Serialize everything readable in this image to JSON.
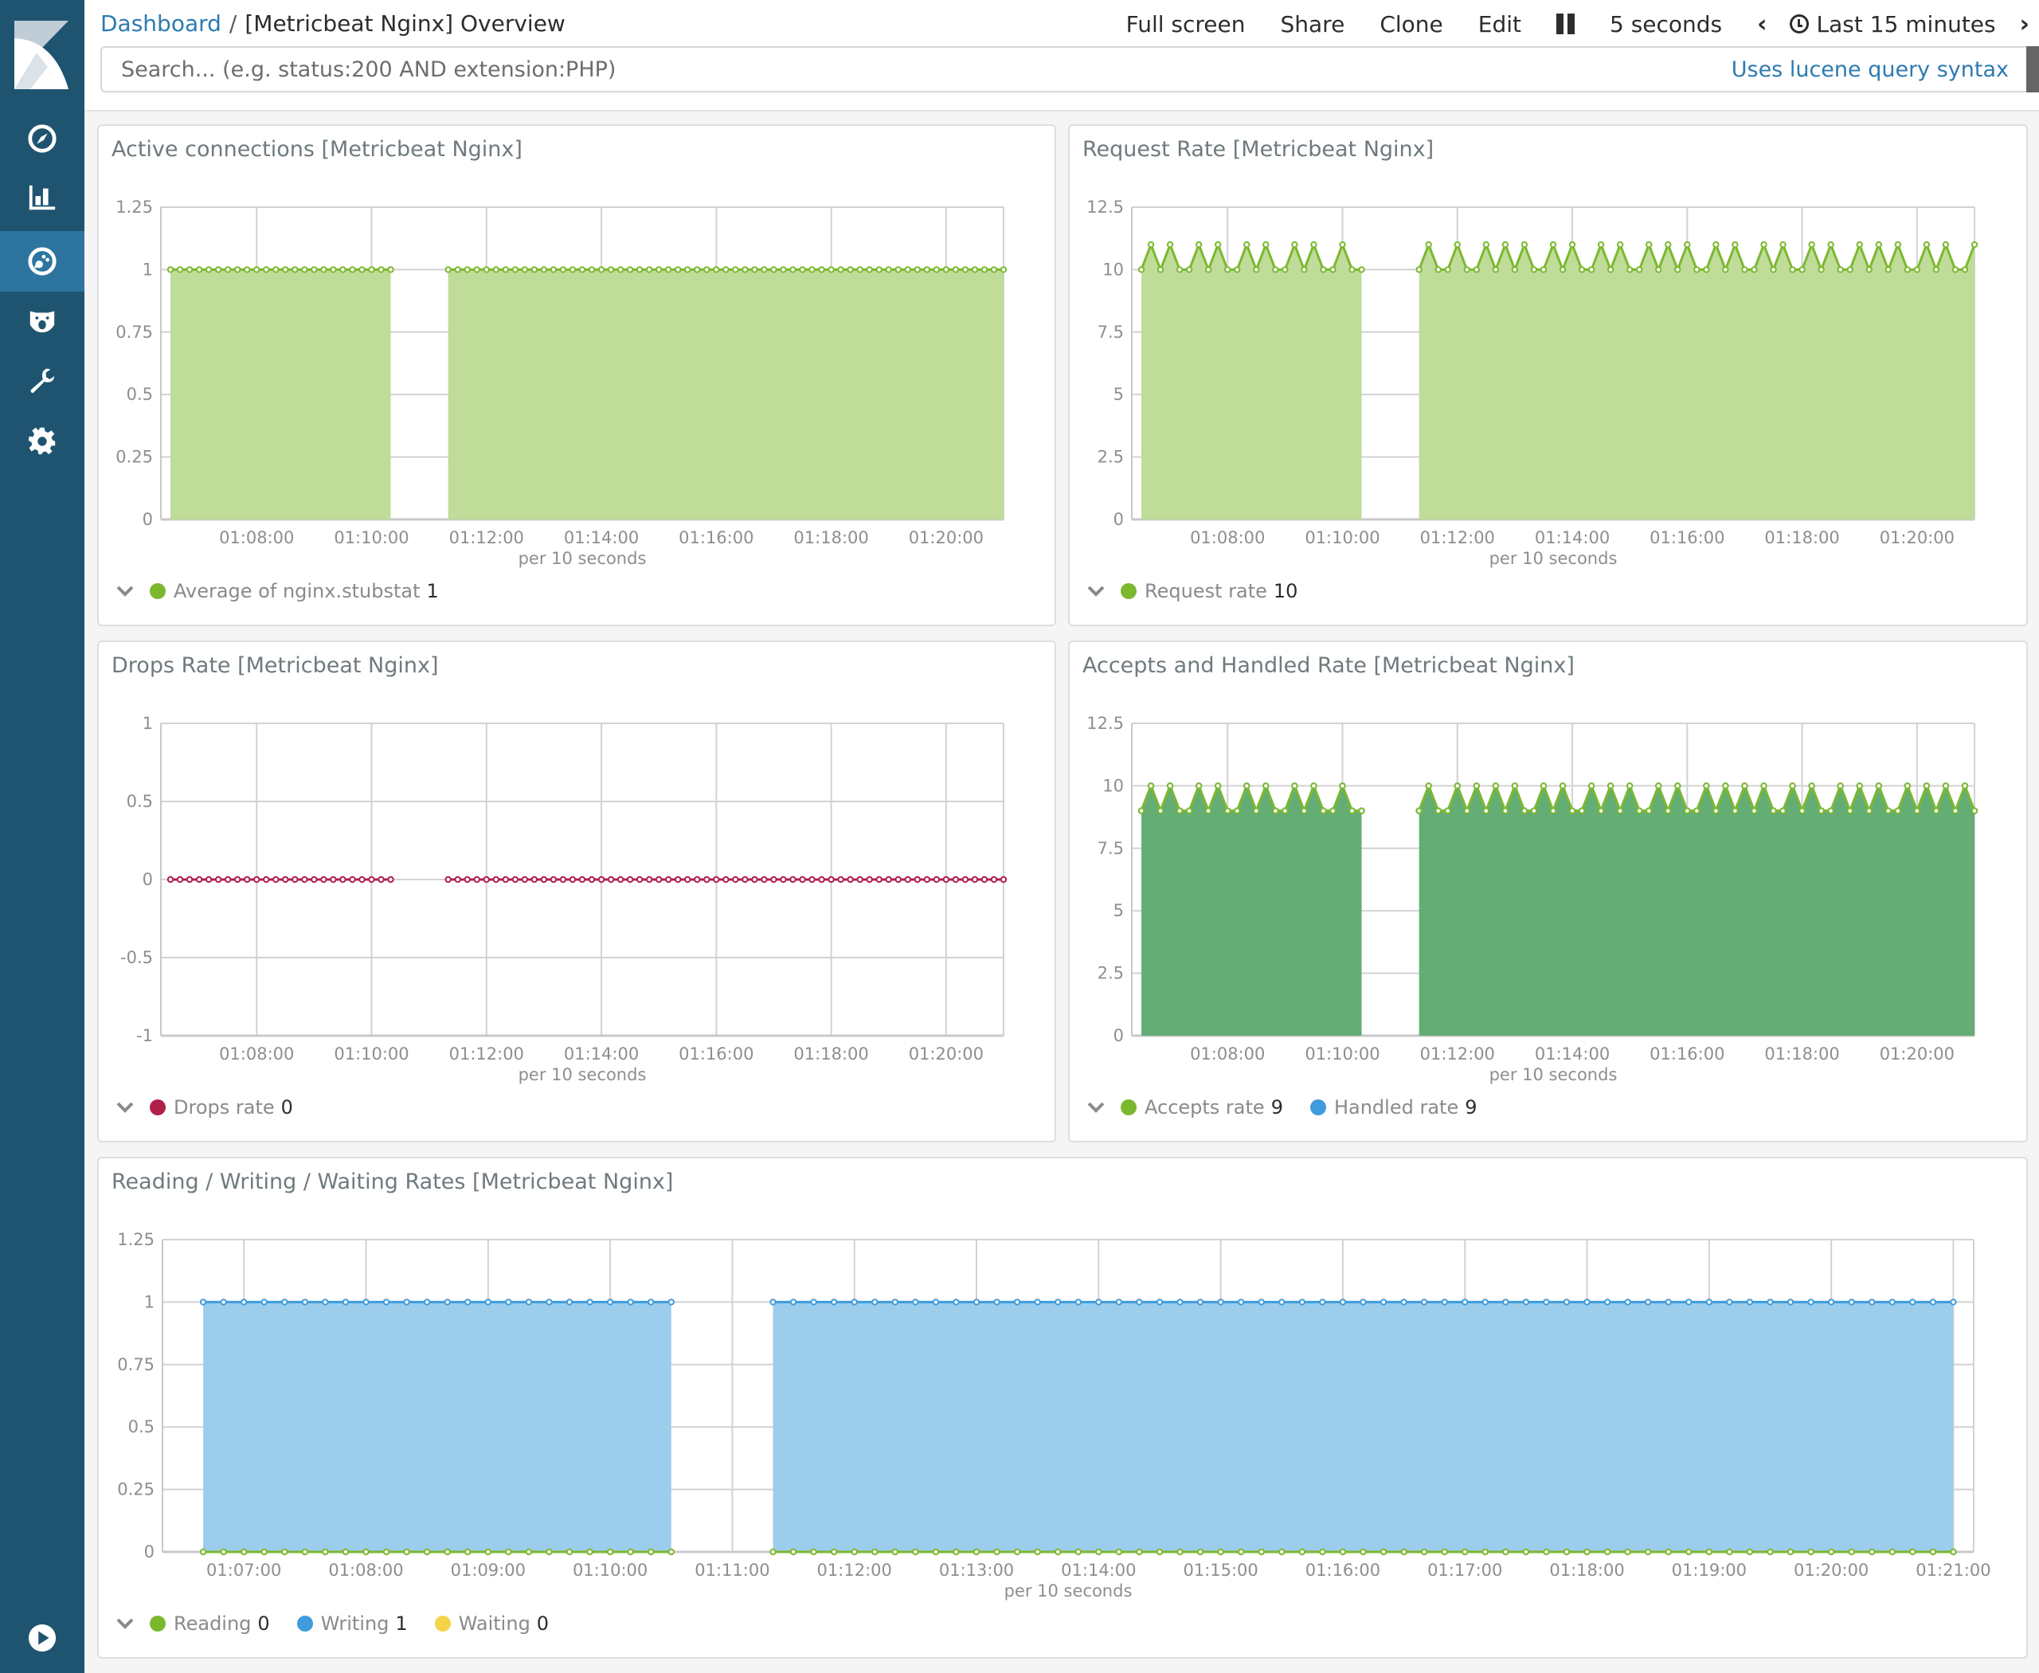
{
  "sidebar": {
    "logo": "kibana-logo",
    "items": [
      {
        "name": "discover",
        "icon": "compass-icon",
        "active": false
      },
      {
        "name": "visualize",
        "icon": "bar-chart-icon",
        "active": false
      },
      {
        "name": "dashboard",
        "icon": "dashboard-gauge-icon",
        "active": true
      },
      {
        "name": "timelion",
        "icon": "bear-icon",
        "active": false
      },
      {
        "name": "dev-tools",
        "icon": "wrench-icon",
        "active": false
      },
      {
        "name": "management",
        "icon": "gear-icon",
        "active": false
      }
    ],
    "collapse": {
      "icon": "play-circle-icon"
    }
  },
  "header": {
    "breadcrumb_root": "Dashboard",
    "breadcrumb_sep": "/",
    "title": "[Metricbeat Nginx] Overview",
    "menu": {
      "full_screen": "Full screen",
      "share": "Share",
      "clone": "Clone",
      "edit": "Edit",
      "refresh_interval": "5 seconds",
      "time_range": "Last 15 minutes"
    }
  },
  "search": {
    "value": "",
    "placeholder": "Search... (e.g. status:200 AND extension:PHP)",
    "syntax_link": "Uses lucene query syntax"
  },
  "colors": {
    "green": "#7cb82f",
    "green_fill": "#bfdc99",
    "dark_green_fill": "#64ad74",
    "blue": "#3f9bdc",
    "blue_fill": "#9ccdec",
    "red": "#b0204a",
    "yellow": "#f4d54a"
  },
  "panels": [
    {
      "title": "Active connections [Metricbeat Nginx]",
      "x_axis_label": "per 10 seconds",
      "legend": [
        {
          "label": "Average of nginx.stubstat",
          "value": "1",
          "color": "#7cb82f"
        }
      ]
    },
    {
      "title": "Request Rate [Metricbeat Nginx]",
      "x_axis_label": "per 10 seconds",
      "legend": [
        {
          "label": "Request rate",
          "value": "10",
          "color": "#7cb82f"
        }
      ]
    },
    {
      "title": "Drops Rate [Metricbeat Nginx]",
      "x_axis_label": "per 10 seconds",
      "legend": [
        {
          "label": "Drops rate",
          "value": "0",
          "color": "#b0204a"
        }
      ]
    },
    {
      "title": "Accepts and Handled Rate [Metricbeat Nginx]",
      "x_axis_label": "per 10 seconds",
      "legend": [
        {
          "label": "Accepts rate",
          "value": "9",
          "color": "#7cb82f"
        },
        {
          "label": "Handled rate",
          "value": "9",
          "color": "#3f9bdc"
        }
      ]
    },
    {
      "title": "Reading / Writing / Waiting Rates [Metricbeat Nginx]",
      "x_axis_label": "per 10 seconds",
      "legend": [
        {
          "label": "Reading",
          "value": "0",
          "color": "#7cb82f"
        },
        {
          "label": "Writing",
          "value": "1",
          "color": "#3f9bdc"
        },
        {
          "label": "Waiting",
          "value": "0",
          "color": "#f4d54a"
        }
      ]
    }
  ],
  "chart_data": [
    {
      "type": "area",
      "title": "Active connections [Metricbeat Nginx]",
      "xlabel": "per 10 seconds",
      "ylabel": "",
      "x_range": [
        "01:06:20",
        "01:21:00"
      ],
      "x_ticks": [
        "01:08:00",
        "01:10:00",
        "01:12:00",
        "01:14:00",
        "01:16:00",
        "01:18:00",
        "01:20:00"
      ],
      "y_ticks": [
        0,
        0.25,
        0.5,
        0.75,
        1,
        1.25
      ],
      "ylim": [
        0,
        1.25
      ],
      "grid": true,
      "interval_seconds": 10,
      "segments": [
        {
          "start": "01:06:30",
          "end": "01:10:20"
        },
        {
          "start": "01:11:20",
          "end": "01:21:00"
        }
      ],
      "series": [
        {
          "name": "Average of nginx.stubstat",
          "color": "#7cb82f",
          "pattern": [
            1
          ],
          "note": "constant 1 across all points"
        }
      ]
    },
    {
      "type": "area",
      "title": "Request Rate [Metricbeat Nginx]",
      "xlabel": "per 10 seconds",
      "x_range": [
        "01:06:20",
        "01:21:00"
      ],
      "x_ticks": [
        "01:08:00",
        "01:10:00",
        "01:12:00",
        "01:14:00",
        "01:16:00",
        "01:18:00",
        "01:20:00"
      ],
      "y_ticks": [
        0,
        2.5,
        5,
        7.5,
        10,
        12.5
      ],
      "ylim": [
        0,
        12.5
      ],
      "grid": true,
      "interval_seconds": 10,
      "segments": [
        {
          "start": "01:06:30",
          "end": "01:10:20"
        },
        {
          "start": "01:11:20",
          "end": "01:21:00"
        }
      ],
      "series": [
        {
          "name": "Request rate",
          "color": "#7cb82f",
          "segment_values": [
            [
              10,
              11,
              10,
              11,
              10,
              10,
              11,
              10,
              11,
              10,
              10,
              11,
              10,
              11,
              10,
              10,
              11,
              10,
              11,
              10,
              10,
              11,
              10
            ],
            [
              10,
              11,
              10,
              10,
              11,
              10,
              10,
              11,
              10,
              11,
              10,
              11,
              10,
              10,
              11,
              10,
              11,
              10,
              10,
              11,
              10,
              11,
              10,
              10,
              11,
              10,
              11,
              10,
              11,
              10,
              10,
              11,
              10,
              11,
              10,
              10,
              11,
              10,
              11,
              10,
              10,
              11,
              10,
              11,
              10,
              10,
              11,
              10,
              11,
              10,
              11,
              10,
              10,
              11,
              10,
              11,
              10,
              10,
              11
            ]
          ]
        }
      ]
    },
    {
      "type": "line",
      "title": "Drops Rate [Metricbeat Nginx]",
      "xlabel": "per 10 seconds",
      "x_range": [
        "01:06:20",
        "01:21:00"
      ],
      "x_ticks": [
        "01:08:00",
        "01:10:00",
        "01:12:00",
        "01:14:00",
        "01:16:00",
        "01:18:00",
        "01:20:00"
      ],
      "y_ticks": [
        -1,
        -0.5,
        0,
        0.5,
        1
      ],
      "ylim": [
        -1,
        1
      ],
      "grid": true,
      "interval_seconds": 10,
      "segments": [
        {
          "start": "01:06:30",
          "end": "01:10:20"
        },
        {
          "start": "01:11:20",
          "end": "01:21:00"
        }
      ],
      "series": [
        {
          "name": "Drops rate",
          "color": "#b0204a",
          "pattern": [
            0
          ],
          "note": "constant 0"
        }
      ]
    },
    {
      "type": "area",
      "title": "Accepts and Handled Rate [Metricbeat Nginx]",
      "xlabel": "per 10 seconds",
      "x_range": [
        "01:06:20",
        "01:21:00"
      ],
      "x_ticks": [
        "01:08:00",
        "01:10:00",
        "01:12:00",
        "01:14:00",
        "01:16:00",
        "01:18:00",
        "01:20:00"
      ],
      "y_ticks": [
        0,
        2.5,
        5,
        7.5,
        10,
        12.5
      ],
      "ylim": [
        0,
        12.5
      ],
      "grid": true,
      "interval_seconds": 10,
      "segments": [
        {
          "start": "01:06:30",
          "end": "01:10:20"
        },
        {
          "start": "01:11:20",
          "end": "01:21:00"
        }
      ],
      "series": [
        {
          "name": "Accepts rate",
          "color": "#7cb82f",
          "segment_values": [
            [
              9,
              10,
              9,
              10,
              9,
              9,
              10,
              9,
              10,
              9,
              9,
              10,
              9,
              10,
              9,
              9,
              10,
              9,
              10,
              9,
              9,
              10,
              9
            ],
            [
              9,
              10,
              9,
              9,
              10,
              9,
              10,
              9,
              10,
              9,
              10,
              9,
              9,
              10,
              9,
              10,
              9,
              9,
              10,
              9,
              10,
              9,
              10,
              9,
              9,
              10,
              9,
              10,
              9,
              9,
              10,
              9,
              10,
              9,
              10,
              9,
              10,
              9,
              9,
              10,
              9,
              10,
              9,
              9,
              10,
              9,
              10,
              9,
              10,
              9,
              9,
              10,
              9,
              10,
              9,
              10,
              9,
              10,
              9
            ]
          ]
        },
        {
          "name": "Handled rate",
          "color": "#3f9bdc",
          "same_as": "Accepts rate"
        }
      ]
    },
    {
      "type": "area",
      "title": "Reading / Writing / Waiting Rates [Metricbeat Nginx]",
      "xlabel": "per 10 seconds",
      "x_range": [
        "01:06:20",
        "01:21:10"
      ],
      "x_ticks": [
        "01:07:00",
        "01:08:00",
        "01:09:00",
        "01:10:00",
        "01:11:00",
        "01:12:00",
        "01:13:00",
        "01:14:00",
        "01:15:00",
        "01:16:00",
        "01:17:00",
        "01:18:00",
        "01:19:00",
        "01:20:00",
        "01:21:00"
      ],
      "y_ticks": [
        0,
        0.25,
        0.5,
        0.75,
        1,
        1.25
      ],
      "ylim": [
        0,
        1.25
      ],
      "grid": true,
      "interval_seconds": 10,
      "segments": [
        {
          "start": "01:06:40",
          "end": "01:10:30"
        },
        {
          "start": "01:11:20",
          "end": "01:21:00"
        }
      ],
      "series": [
        {
          "name": "Reading",
          "color": "#7cb82f",
          "pattern": [
            0
          ]
        },
        {
          "name": "Writing",
          "color": "#3f9bdc",
          "pattern": [
            1
          ]
        },
        {
          "name": "Waiting",
          "color": "#f4d54a",
          "pattern": [
            0
          ]
        }
      ]
    }
  ]
}
